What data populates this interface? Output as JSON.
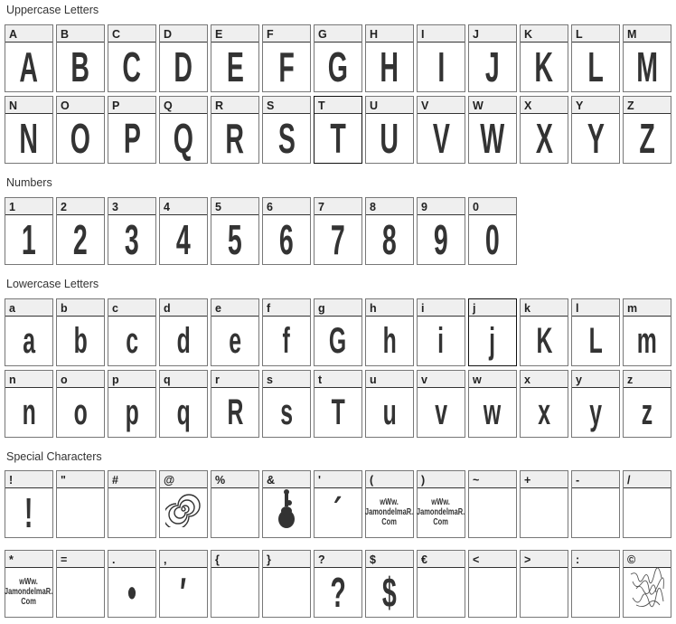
{
  "sections": [
    {
      "title": "Uppercase Letters",
      "kind": "upper",
      "rows": [
        [
          {
            "label": "A",
            "glyph": "A"
          },
          {
            "label": "B",
            "glyph": "B"
          },
          {
            "label": "C",
            "glyph": "C"
          },
          {
            "label": "D",
            "glyph": "D"
          },
          {
            "label": "E",
            "glyph": "E"
          },
          {
            "label": "F",
            "glyph": "F"
          },
          {
            "label": "G",
            "glyph": "G"
          },
          {
            "label": "H",
            "glyph": "H"
          },
          {
            "label": "I",
            "glyph": "I"
          },
          {
            "label": "J",
            "glyph": "J"
          },
          {
            "label": "K",
            "glyph": "K"
          },
          {
            "label": "L",
            "glyph": "L"
          },
          {
            "label": "M",
            "glyph": "M"
          }
        ],
        [
          {
            "label": "N",
            "glyph": "N"
          },
          {
            "label": "O",
            "glyph": "O"
          },
          {
            "label": "P",
            "glyph": "P"
          },
          {
            "label": "Q",
            "glyph": "Q"
          },
          {
            "label": "R",
            "glyph": "R"
          },
          {
            "label": "S",
            "glyph": "S"
          },
          {
            "label": "T",
            "glyph": "T",
            "active": true
          },
          {
            "label": "U",
            "glyph": "U"
          },
          {
            "label": "V",
            "glyph": "V"
          },
          {
            "label": "W",
            "glyph": "W"
          },
          {
            "label": "X",
            "glyph": "X"
          },
          {
            "label": "Y",
            "glyph": "Y"
          },
          {
            "label": "Z",
            "glyph": "Z"
          }
        ]
      ]
    },
    {
      "title": "Numbers",
      "kind": "upper",
      "rows": [
        [
          {
            "label": "1",
            "glyph": "1"
          },
          {
            "label": "2",
            "glyph": "2"
          },
          {
            "label": "3",
            "glyph": "3"
          },
          {
            "label": "4",
            "glyph": "4"
          },
          {
            "label": "5",
            "glyph": "5"
          },
          {
            "label": "6",
            "glyph": "6"
          },
          {
            "label": "7",
            "glyph": "7"
          },
          {
            "label": "8",
            "glyph": "8"
          },
          {
            "label": "9",
            "glyph": "9"
          },
          {
            "label": "0",
            "glyph": "0"
          }
        ]
      ]
    },
    {
      "title": "Lowercase Letters",
      "kind": "lower",
      "rows": [
        [
          {
            "label": "a",
            "glyph": "a"
          },
          {
            "label": "b",
            "glyph": "b"
          },
          {
            "label": "c",
            "glyph": "c"
          },
          {
            "label": "d",
            "glyph": "d"
          },
          {
            "label": "e",
            "glyph": "e"
          },
          {
            "label": "f",
            "glyph": "f"
          },
          {
            "label": "g",
            "glyph": "G"
          },
          {
            "label": "h",
            "glyph": "h"
          },
          {
            "label": "i",
            "glyph": "i"
          },
          {
            "label": "j",
            "glyph": "j",
            "active": true
          },
          {
            "label": "k",
            "glyph": "K"
          },
          {
            "label": "l",
            "glyph": "L"
          },
          {
            "label": "m",
            "glyph": "m"
          }
        ],
        [
          {
            "label": "n",
            "glyph": "n"
          },
          {
            "label": "o",
            "glyph": "o"
          },
          {
            "label": "p",
            "glyph": "p"
          },
          {
            "label": "q",
            "glyph": "q"
          },
          {
            "label": "r",
            "glyph": "R"
          },
          {
            "label": "s",
            "glyph": "s"
          },
          {
            "label": "t",
            "glyph": "T"
          },
          {
            "label": "u",
            "glyph": "u"
          },
          {
            "label": "v",
            "glyph": "v"
          },
          {
            "label": "w",
            "glyph": "w"
          },
          {
            "label": "x",
            "glyph": "x"
          },
          {
            "label": "y",
            "glyph": "y"
          },
          {
            "label": "z",
            "glyph": "z"
          }
        ]
      ]
    },
    {
      "title": "Special Characters",
      "kind": "special",
      "rows": [
        [
          {
            "label": "!",
            "glyph": "!"
          },
          {
            "label": "\"",
            "glyph": ""
          },
          {
            "label": "#",
            "glyph": ""
          },
          {
            "label": "@",
            "glyph": "",
            "icon": "spiral-icon"
          },
          {
            "label": "%",
            "glyph": ""
          },
          {
            "label": "&",
            "glyph": "",
            "icon": "guitar-icon"
          },
          {
            "label": "'",
            "glyph": "´"
          },
          {
            "label": "(",
            "glyph": "",
            "watermark": [
              "wWw.",
              "JamondelmaR.",
              "Com"
            ]
          },
          {
            "label": ")",
            "glyph": "",
            "watermark": [
              "wWw.",
              "JamondelmaR.",
              "Com"
            ]
          },
          {
            "label": "~",
            "glyph": ""
          },
          {
            "label": "+",
            "glyph": ""
          },
          {
            "label": "-",
            "glyph": ""
          },
          {
            "label": "/",
            "glyph": ""
          }
        ],
        [
          {
            "label": "*",
            "glyph": "",
            "watermark": [
              "wWw.",
              "JamondelmaR.",
              "Com"
            ]
          },
          {
            "label": "=",
            "glyph": ""
          },
          {
            "label": ".",
            "glyph": "•"
          },
          {
            "label": ",",
            "glyph": "′"
          },
          {
            "label": "{",
            "glyph": ""
          },
          {
            "label": "}",
            "glyph": ""
          },
          {
            "label": "?",
            "glyph": "?"
          },
          {
            "label": "$",
            "glyph": "$"
          },
          {
            "label": "€",
            "glyph": ""
          },
          {
            "label": "<",
            "glyph": ""
          },
          {
            "label": ">",
            "glyph": ""
          },
          {
            "label": ":",
            "glyph": ""
          },
          {
            "label": "©",
            "glyph": "",
            "icon": "signature-icon"
          }
        ]
      ]
    }
  ]
}
